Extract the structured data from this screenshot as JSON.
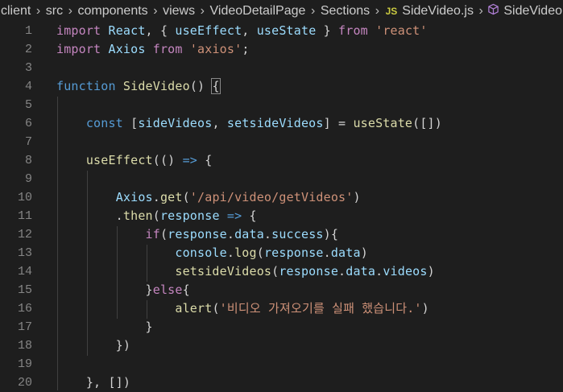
{
  "breadcrumb": {
    "segments": [
      "client",
      "src",
      "components",
      "views",
      "VideoDetailPage",
      "Sections"
    ],
    "file_badge": "JS",
    "file_name": "SideVideo.js",
    "symbol_icon": "cube-icon",
    "symbol_name": "SideVideo"
  },
  "editor": {
    "lines": [
      {
        "n": "1",
        "tokens": [
          [
            "kw2",
            "import"
          ],
          [
            "p",
            " "
          ],
          [
            "var",
            "React"
          ],
          [
            "p",
            ", { "
          ],
          [
            "var",
            "useEffect"
          ],
          [
            "p",
            ", "
          ],
          [
            "var",
            "useState"
          ],
          [
            "p",
            " } "
          ],
          [
            "kw2",
            "from"
          ],
          [
            "p",
            " "
          ],
          [
            "str",
            "'react'"
          ]
        ]
      },
      {
        "n": "2",
        "tokens": [
          [
            "kw2",
            "import"
          ],
          [
            "p",
            " "
          ],
          [
            "var",
            "Axios"
          ],
          [
            "p",
            " "
          ],
          [
            "kw2",
            "from"
          ],
          [
            "p",
            " "
          ],
          [
            "str",
            "'axios'"
          ],
          [
            "p",
            ";"
          ]
        ]
      },
      {
        "n": "3",
        "tokens": []
      },
      {
        "n": "4",
        "tokens": [
          [
            "kw",
            "function"
          ],
          [
            "p",
            " "
          ],
          [
            "fn",
            "SideVideo"
          ],
          [
            "p",
            "() "
          ],
          [
            "hl",
            "{"
          ]
        ]
      },
      {
        "n": "5",
        "tokens": []
      },
      {
        "n": "6",
        "tokens": [
          [
            "p",
            "    "
          ],
          [
            "kw",
            "const"
          ],
          [
            "p",
            " ["
          ],
          [
            "var",
            "sideVideos"
          ],
          [
            "p",
            ", "
          ],
          [
            "var",
            "setsideVideos"
          ],
          [
            "p",
            "] = "
          ],
          [
            "fn",
            "useState"
          ],
          [
            "p",
            "([])"
          ]
        ]
      },
      {
        "n": "7",
        "tokens": []
      },
      {
        "n": "8",
        "tokens": [
          [
            "p",
            "    "
          ],
          [
            "fn",
            "useEffect"
          ],
          [
            "p",
            "(() "
          ],
          [
            "kw",
            "=>"
          ],
          [
            "p",
            " {"
          ]
        ]
      },
      {
        "n": "9",
        "tokens": []
      },
      {
        "n": "10",
        "tokens": [
          [
            "p",
            "        "
          ],
          [
            "var",
            "Axios"
          ],
          [
            "p",
            "."
          ],
          [
            "fn",
            "get"
          ],
          [
            "p",
            "("
          ],
          [
            "str",
            "'/api/video/getVideos'"
          ],
          [
            "p",
            ")"
          ]
        ]
      },
      {
        "n": "11",
        "tokens": [
          [
            "p",
            "        ."
          ],
          [
            "fn",
            "then"
          ],
          [
            "p",
            "("
          ],
          [
            "var",
            "response"
          ],
          [
            "p",
            " "
          ],
          [
            "kw",
            "=>"
          ],
          [
            "p",
            " {"
          ]
        ]
      },
      {
        "n": "12",
        "tokens": [
          [
            "p",
            "            "
          ],
          [
            "ctrl",
            "if"
          ],
          [
            "p",
            "("
          ],
          [
            "var",
            "response"
          ],
          [
            "p",
            "."
          ],
          [
            "var",
            "data"
          ],
          [
            "p",
            "."
          ],
          [
            "var",
            "success"
          ],
          [
            "p",
            "){"
          ]
        ]
      },
      {
        "n": "13",
        "tokens": [
          [
            "p",
            "                "
          ],
          [
            "var",
            "console"
          ],
          [
            "p",
            "."
          ],
          [
            "fn",
            "log"
          ],
          [
            "p",
            "("
          ],
          [
            "var",
            "response"
          ],
          [
            "p",
            "."
          ],
          [
            "var",
            "data"
          ],
          [
            "p",
            ")"
          ]
        ]
      },
      {
        "n": "14",
        "tokens": [
          [
            "p",
            "                "
          ],
          [
            "fn",
            "setsideVideos"
          ],
          [
            "p",
            "("
          ],
          [
            "var",
            "response"
          ],
          [
            "p",
            "."
          ],
          [
            "var",
            "data"
          ],
          [
            "p",
            "."
          ],
          [
            "var",
            "videos"
          ],
          [
            "p",
            ")"
          ]
        ]
      },
      {
        "n": "15",
        "tokens": [
          [
            "p",
            "            }"
          ],
          [
            "ctrl",
            "else"
          ],
          [
            "p",
            "{"
          ]
        ]
      },
      {
        "n": "16",
        "tokens": [
          [
            "p",
            "                "
          ],
          [
            "fn",
            "alert"
          ],
          [
            "p",
            "("
          ],
          [
            "str",
            "'비디오 가져오기를 실패 했습니다.'"
          ],
          [
            "p",
            ")"
          ]
        ]
      },
      {
        "n": "17",
        "tokens": [
          [
            "p",
            "            }"
          ]
        ]
      },
      {
        "n": "18",
        "tokens": [
          [
            "p",
            "        })"
          ]
        ]
      },
      {
        "n": "19",
        "tokens": []
      },
      {
        "n": "20",
        "tokens": [
          [
            "p",
            "    }, [])"
          ]
        ]
      }
    ]
  },
  "colors": {
    "background": "#1e1e1e",
    "keyword": "#569cd6",
    "control": "#c586c0",
    "function": "#dcdcaa",
    "variable": "#9cdcfe",
    "string": "#ce9178",
    "line_number": "#858585"
  }
}
